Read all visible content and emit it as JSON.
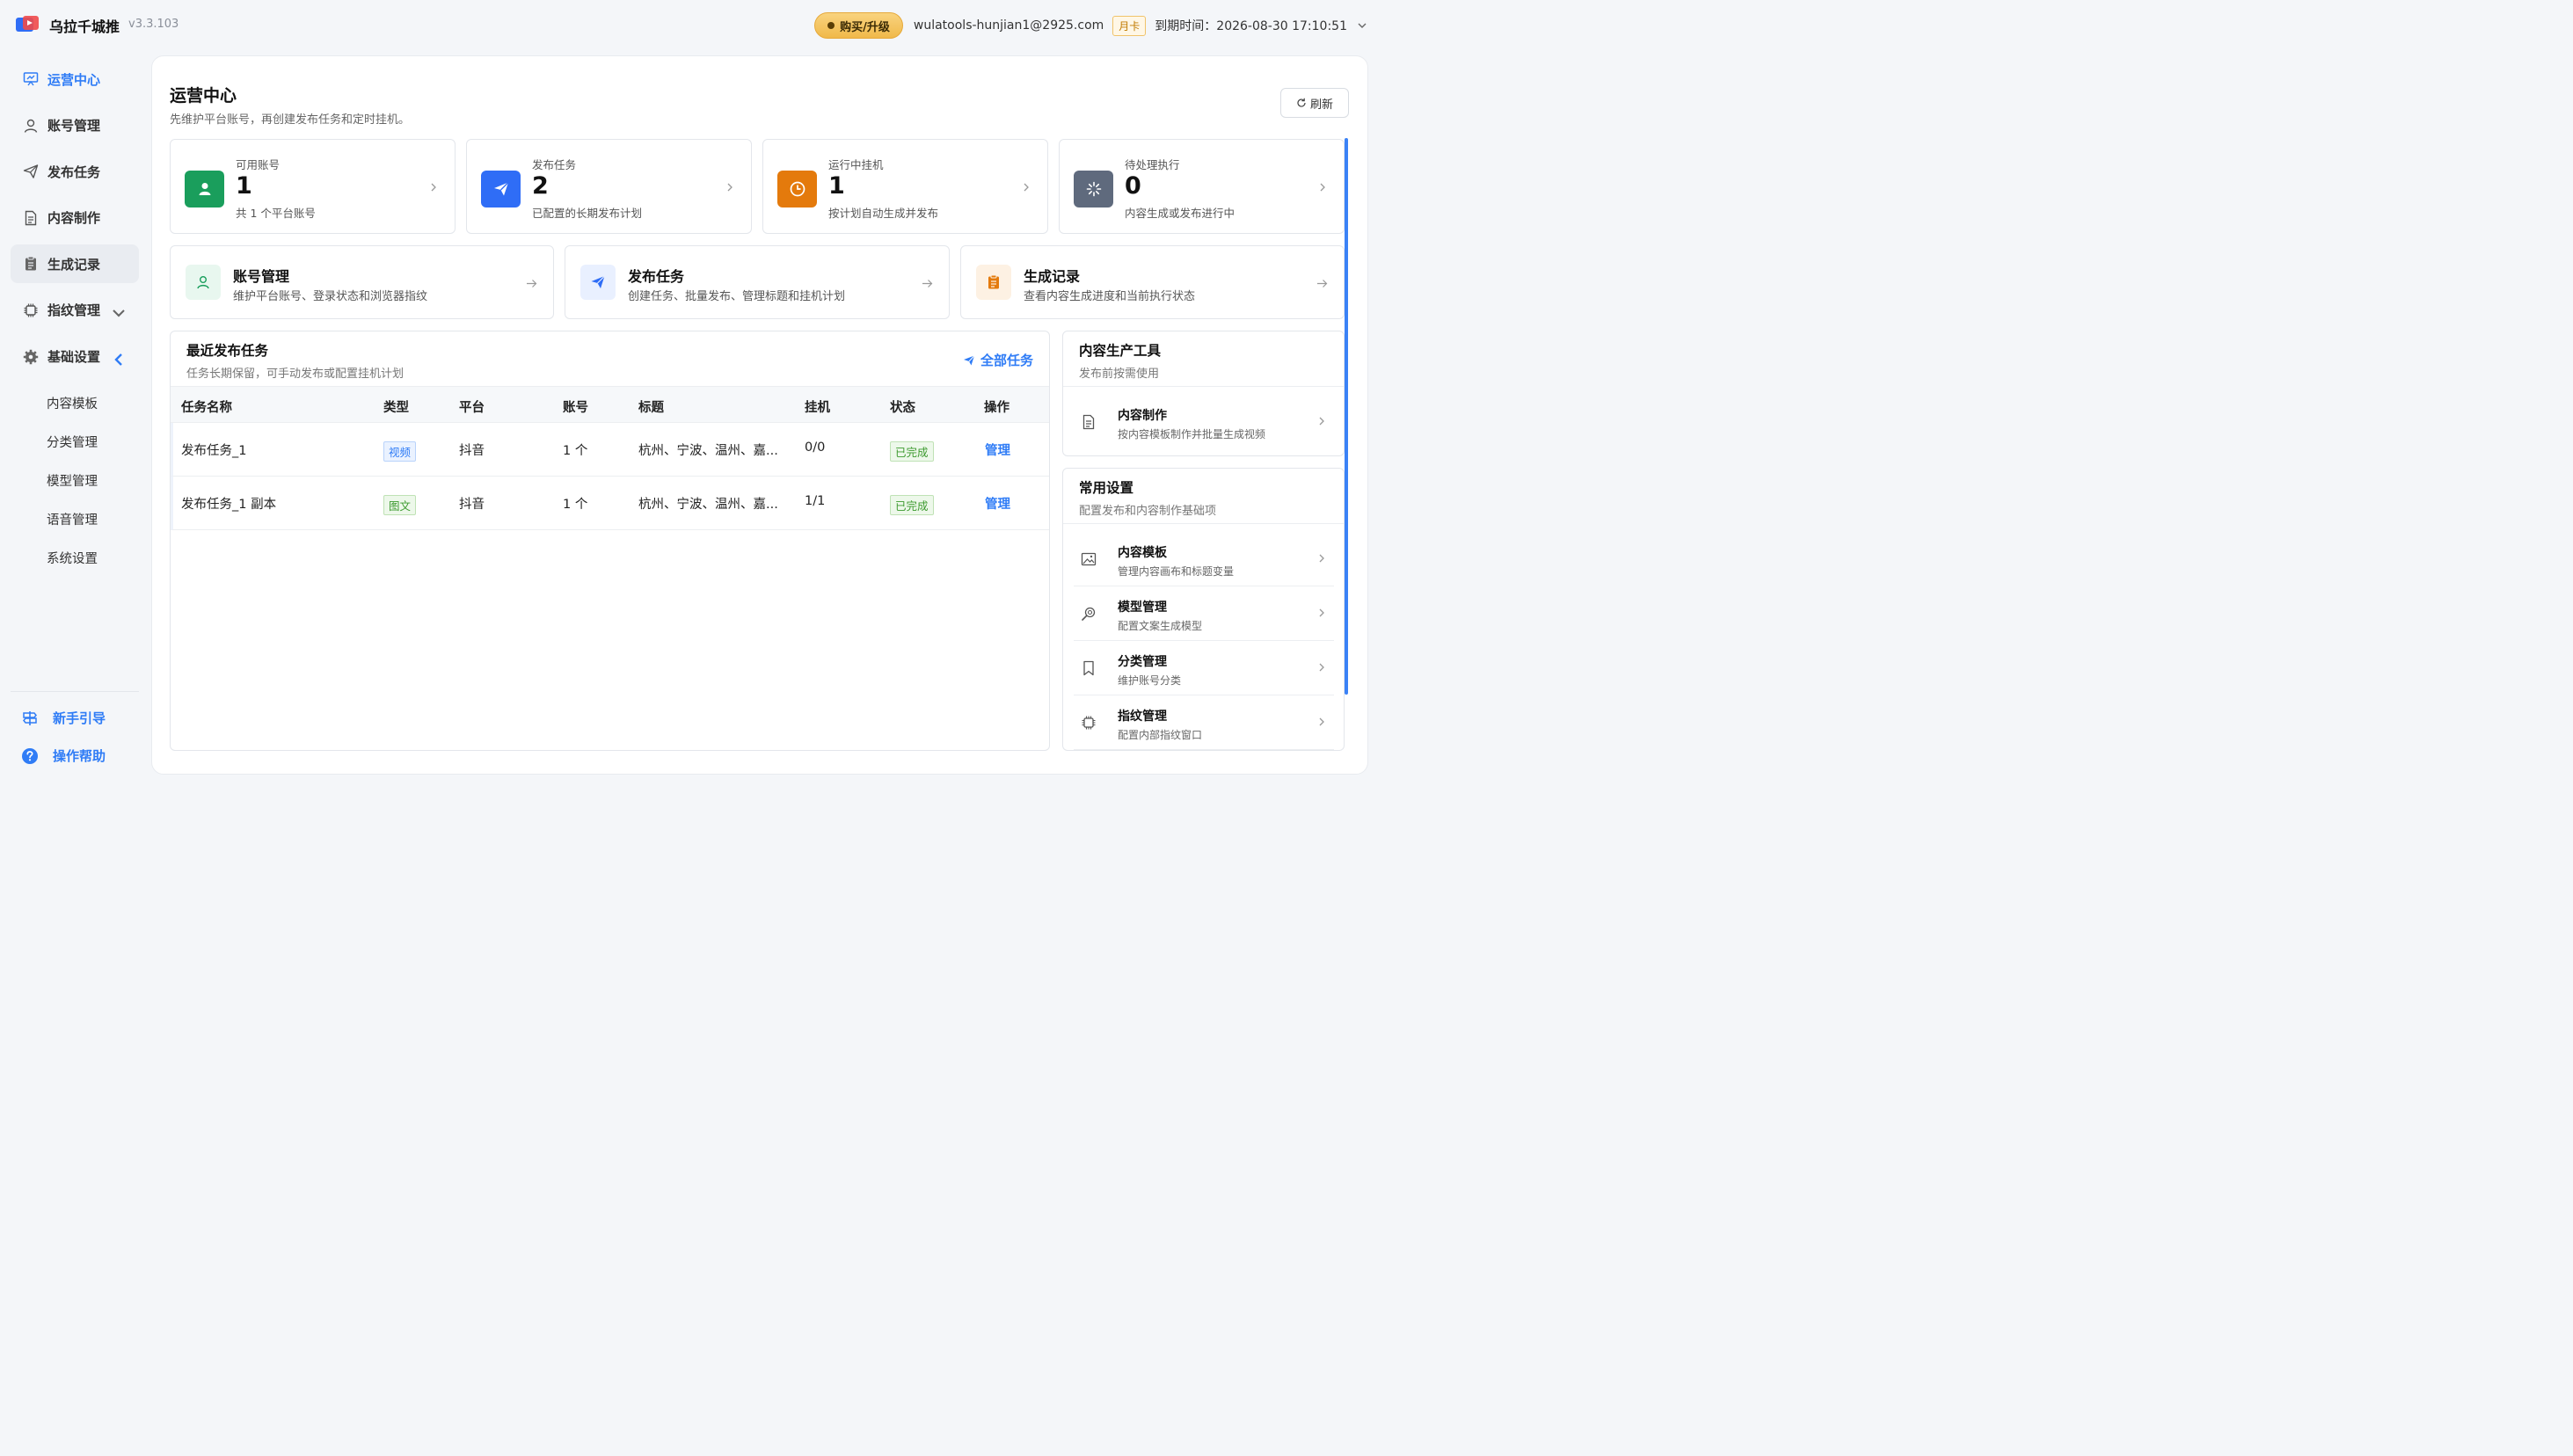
{
  "app": {
    "name": "乌拉千城推",
    "version": "v3.3.103"
  },
  "header": {
    "buy_label": "购买/升级",
    "email": "wulatools-hunjian1@2925.com",
    "plan": "月卡",
    "expire": "到期时间：2026-08-30 17:10:51"
  },
  "sidebar": {
    "items": [
      {
        "label": "运营中心",
        "icon": "monitor-icon"
      },
      {
        "label": "账号管理",
        "icon": "user-icon"
      },
      {
        "label": "发布任务",
        "icon": "send-icon"
      },
      {
        "label": "内容制作",
        "icon": "document-icon"
      },
      {
        "label": "生成记录",
        "icon": "clipboard-icon"
      },
      {
        "label": "指纹管理",
        "icon": "chip-icon"
      },
      {
        "label": "基础设置",
        "icon": "gear-icon"
      }
    ],
    "sub_items": [
      "内容模板",
      "分类管理",
      "模型管理",
      "语音管理",
      "系统设置"
    ],
    "bottom": {
      "guide": "新手引导",
      "help": "操作帮助"
    }
  },
  "main": {
    "title": "运营中心",
    "subtitle": "先维护平台账号，再创建发布任务和定时挂机。",
    "refresh_label": "刷新",
    "stats": [
      {
        "label": "可用账号",
        "value": "1",
        "desc": "共 1 个平台账号",
        "color": "#1a9e5c"
      },
      {
        "label": "发布任务",
        "value": "2",
        "desc": "已配置的长期发布计划",
        "color": "#2f6df6"
      },
      {
        "label": "运行中挂机",
        "value": "1",
        "desc": "按计划自动生成并发布",
        "color": "#e47a0c"
      },
      {
        "label": "待处理执行",
        "value": "0",
        "desc": "内容生成或发布进行中",
        "color": "#5f6a7d"
      }
    ],
    "quick": [
      {
        "title": "账号管理",
        "desc": "维护平台账号、登录状态和浏览器指纹"
      },
      {
        "title": "发布任务",
        "desc": "创建任务、批量发布、管理标题和挂机计划"
      },
      {
        "title": "生成记录",
        "desc": "查看内容生成进度和当前执行状态"
      }
    ],
    "recent": {
      "title": "最近发布任务",
      "subtitle": "任务长期保留，可手动发布或配置挂机计划",
      "all_label": "全部任务",
      "columns": [
        "任务名称",
        "类型",
        "平台",
        "账号",
        "标题",
        "挂机",
        "状态",
        "操作"
      ],
      "rows": [
        {
          "name": "发布任务_1",
          "type": "视频",
          "platform": "抖音",
          "accounts": "1 个",
          "title": "杭州、宁波、温州、嘉...",
          "hang": "0/0",
          "status": "已完成",
          "action": "管理"
        },
        {
          "name": "发布任务_1 副本",
          "type": "图文",
          "platform": "抖音",
          "accounts": "1 个",
          "title": "杭州、宁波、温州、嘉...",
          "hang": "1/1",
          "status": "已完成",
          "action": "管理"
        }
      ]
    },
    "tools": {
      "title": "内容生产工具",
      "subtitle": "发布前按需使用",
      "items": [
        {
          "title": "内容制作",
          "desc": "按内容模板制作并批量生成视频"
        }
      ]
    },
    "settings": {
      "title": "常用设置",
      "subtitle": "配置发布和内容制作基础项",
      "items": [
        {
          "title": "内容模板",
          "desc": "管理内容画布和标题变量"
        },
        {
          "title": "模型管理",
          "desc": "配置文案生成模型"
        },
        {
          "title": "分类管理",
          "desc": "维护账号分类"
        },
        {
          "title": "指纹管理",
          "desc": "配置内部指纹窗口"
        }
      ]
    }
  }
}
